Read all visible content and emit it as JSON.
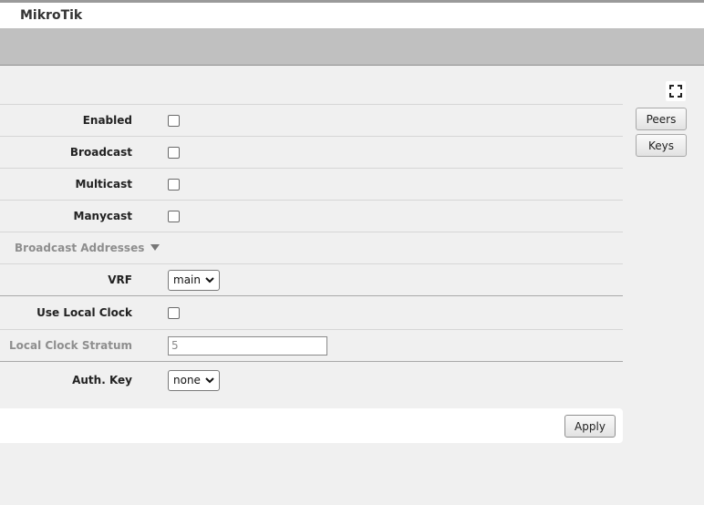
{
  "app": {
    "brand": "MikroTik"
  },
  "side_buttons": {
    "peers": "Peers",
    "keys": "Keys"
  },
  "form": {
    "enabled": {
      "label": "Enabled",
      "checked": false
    },
    "broadcast": {
      "label": "Broadcast",
      "checked": false
    },
    "multicast": {
      "label": "Multicast",
      "checked": false
    },
    "manycast": {
      "label": "Manycast",
      "checked": false
    },
    "broadcast_addresses": {
      "label": "Broadcast Addresses"
    },
    "vrf": {
      "label": "VRF",
      "value": "main"
    },
    "use_local_clock": {
      "label": "Use Local Clock",
      "checked": false
    },
    "local_clock_stratum": {
      "label": "Local Clock Stratum",
      "value": "5"
    },
    "auth_key": {
      "label": "Auth. Key",
      "value": "none"
    }
  },
  "footer": {
    "apply": "Apply"
  },
  "icons": {
    "fullscreen": "fullscreen-icon",
    "dropdown": "chevron-down-icon",
    "section_toggle": "triangle-down-icon"
  }
}
